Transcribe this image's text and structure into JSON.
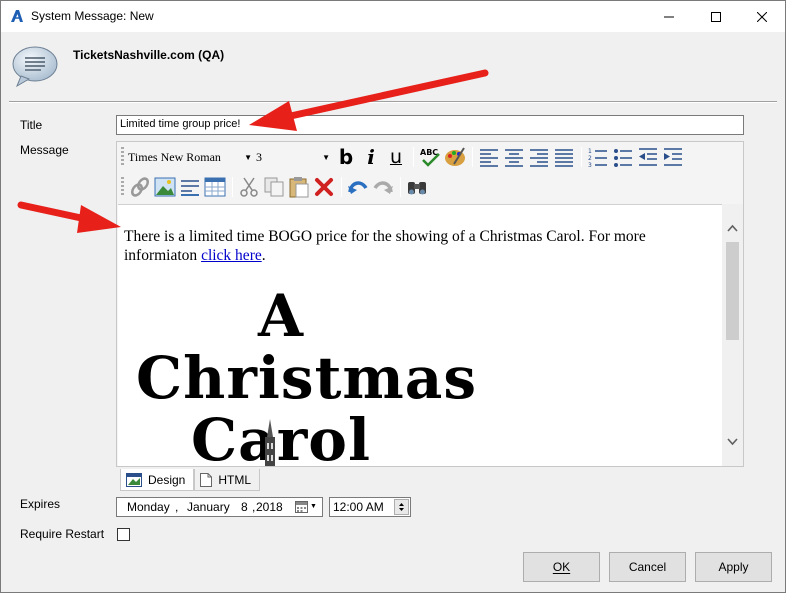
{
  "window": {
    "title": "System Message: New"
  },
  "header": {
    "org_name": "TicketsNashville.com (QA)"
  },
  "form": {
    "title_label": "Title",
    "title_value": "Limited time group price!",
    "message_label": "Message",
    "expires_label": "Expires",
    "require_restart_label": "Require Restart",
    "require_restart_checked": false
  },
  "editor": {
    "font_name": "Times New Roman",
    "font_size": "3",
    "body_text": "There is a limited time BOGO price for the showing of a Christmas Carol. For more informiaton ",
    "link_text": "click here",
    "after_link": ".",
    "image_text_line1": "A Christmas",
    "image_text_line2": "Carol",
    "tabs": [
      {
        "label": "Design",
        "active": true
      },
      {
        "label": "HTML",
        "active": false
      }
    ],
    "toolbar_icons": [
      "bold-icon",
      "italic-icon",
      "underline-icon",
      "spellcheck-icon",
      "color-palette-icon",
      "align-left-icon",
      "align-center-icon",
      "align-right-icon",
      "justify-icon",
      "ordered-list-icon",
      "unordered-list-icon",
      "outdent-icon",
      "indent-icon",
      "link-icon",
      "image-icon",
      "horizontal-rule-icon",
      "table-icon",
      "cut-icon",
      "copy-icon",
      "paste-icon",
      "delete-icon",
      "undo-icon",
      "redo-icon",
      "find-icon"
    ]
  },
  "expires": {
    "weekday": "Monday",
    "month": "January",
    "day": "8",
    "year": "2018",
    "time": "12:00 AM"
  },
  "buttons": {
    "ok": "OK",
    "cancel": "Cancel",
    "apply": "Apply"
  },
  "colors": {
    "arrow_red": "#e8201a",
    "link_blue": "#0000cc"
  }
}
